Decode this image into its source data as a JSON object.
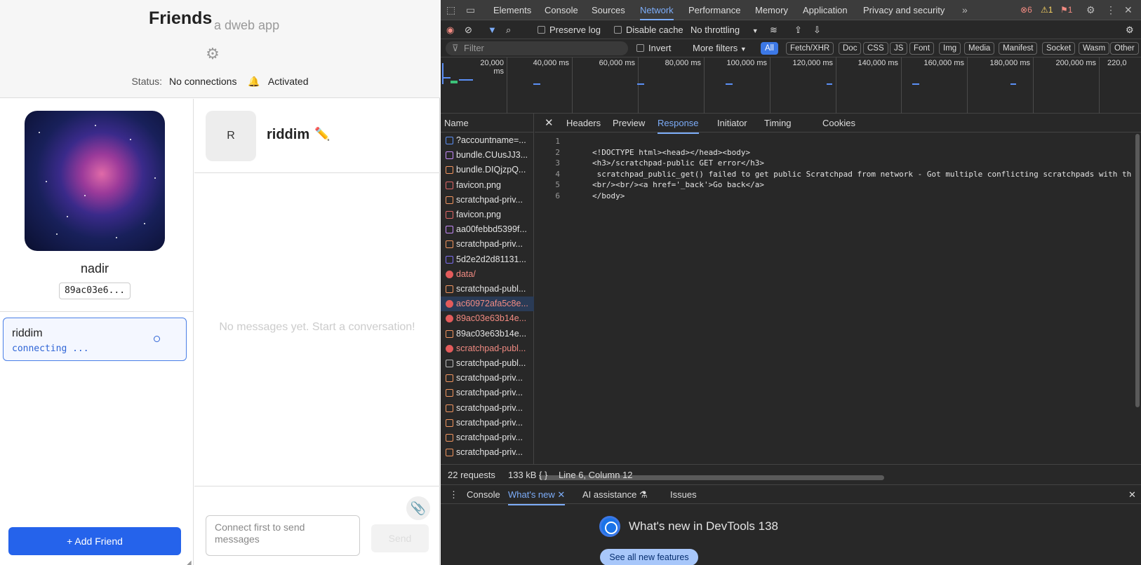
{
  "app": {
    "title": "Friends",
    "subtitle": "a dweb app",
    "status_label": "Status:",
    "status_value": "No connections",
    "activation": "Activated",
    "profile": {
      "name": "nadir",
      "id": "89ac03e6..."
    },
    "friends": [
      {
        "name": "riddim",
        "state": "connecting ..."
      }
    ],
    "add_friend": "+ Add Friend",
    "chat": {
      "avatar_letter": "R",
      "name": "riddim",
      "empty": "No messages yet. Start a conversation!",
      "input_placeholder": "Connect first to send messages",
      "send": "Send"
    }
  },
  "devtools": {
    "tabs": [
      "Elements",
      "Console",
      "Sources",
      "Network",
      "Performance",
      "Memory",
      "Application",
      "Privacy and security"
    ],
    "active_tab": "Network",
    "errors": "6",
    "warnings": "1",
    "issues": "1",
    "toolbar": {
      "preserve_log": "Preserve log",
      "disable_cache": "Disable cache",
      "throttling": "No throttling"
    },
    "filter": {
      "placeholder": "Filter",
      "invert": "Invert",
      "more_filters": "More filters"
    },
    "types": [
      "All",
      "Fetch/XHR",
      "Doc",
      "CSS",
      "JS",
      "Font",
      "Img",
      "Media",
      "Manifest",
      "Socket",
      "Wasm",
      "Other"
    ],
    "timeline_labels": [
      "20,000 ms",
      "40,000 ms",
      "60,000 ms",
      "80,000 ms",
      "100,000 ms",
      "120,000 ms",
      "140,000 ms",
      "160,000 ms",
      "180,000 ms",
      "200,000 ms",
      "220,0"
    ],
    "names_header": "Name",
    "requests": [
      {
        "name": "?accountname=...",
        "kind": "doc"
      },
      {
        "name": "bundle.CUusJJ3...",
        "kind": "js"
      },
      {
        "name": "bundle.DIQjzpQ...",
        "kind": "css"
      },
      {
        "name": "favicon.png",
        "kind": "img"
      },
      {
        "name": "scratchpad-priv...",
        "kind": "fetch"
      },
      {
        "name": "favicon.png",
        "kind": "img"
      },
      {
        "name": "aa00febbd5399f...",
        "kind": "js"
      },
      {
        "name": "scratchpad-priv...",
        "kind": "fetch"
      },
      {
        "name": "5d2e2d2d81131...",
        "kind": "other"
      },
      {
        "name": "data/",
        "kind": "error"
      },
      {
        "name": "scratchpad-publ...",
        "kind": "fetch"
      },
      {
        "name": "ac60972afa5c8e...",
        "kind": "error"
      },
      {
        "name": "89ac03e63b14e...",
        "kind": "error"
      },
      {
        "name": "89ac03e63b14e...",
        "kind": "fetch"
      },
      {
        "name": "scratchpad-publ...",
        "kind": "error"
      },
      {
        "name": "scratchpad-publ...",
        "kind": "file"
      },
      {
        "name": "scratchpad-priv...",
        "kind": "fetch"
      },
      {
        "name": "scratchpad-priv...",
        "kind": "fetch"
      },
      {
        "name": "scratchpad-priv...",
        "kind": "fetch"
      },
      {
        "name": "scratchpad-priv...",
        "kind": "fetch"
      },
      {
        "name": "scratchpad-priv...",
        "kind": "fetch"
      },
      {
        "name": "scratchpad-priv...",
        "kind": "fetch"
      }
    ],
    "detail_tabs": [
      "Headers",
      "Preview",
      "Response",
      "Initiator",
      "Timing",
      "Cookies"
    ],
    "active_detail_tab": "Response",
    "response_lines": [
      "",
      "<!DOCTYPE html><head></head><body>",
      "<h3>/scratchpad-public GET error</h3>",
      " scratchpad_public_get() failed to get public Scratchpad from network - Got multiple conflicting scratchpads with th",
      "<br/><br/><a href='_back'>Go back</a>",
      "</body>"
    ],
    "statusbar": {
      "requests": "22 requests",
      "size": "133 kB",
      "position": "Line 6, Column 12"
    },
    "drawer_tabs": [
      "Console",
      "What's new",
      "AI assistance",
      "Issues"
    ],
    "whats_new": {
      "title": "What's new in DevTools 138",
      "button": "See all new features"
    }
  }
}
